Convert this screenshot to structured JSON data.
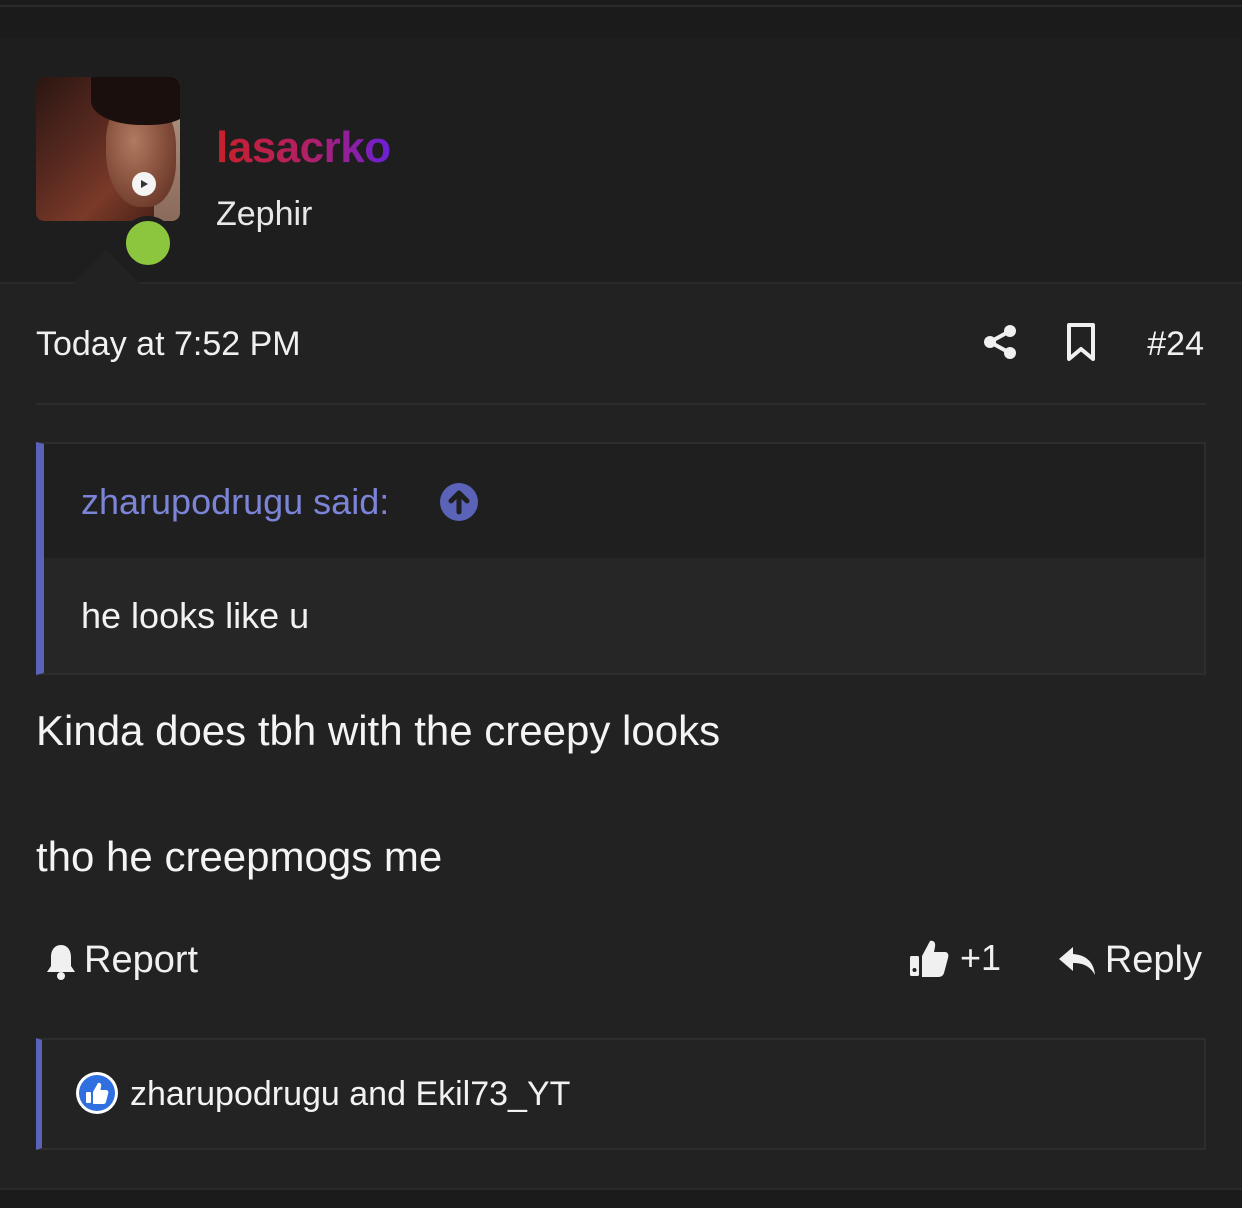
{
  "author": {
    "username": "lasacrko",
    "title": "Zephir",
    "online": true
  },
  "post": {
    "timestamp": "Today at 7:52 PM",
    "number": "#24",
    "quote": {
      "author_line": "zharupodrugu said:",
      "body": "he looks like u"
    },
    "message_lines": [
      "Kinda does tbh with the creepy looks",
      "tho he creepmogs me"
    ]
  },
  "actions": {
    "report_label": "Report",
    "like_label": "+1",
    "reply_label": "Reply"
  },
  "reactions": {
    "users_text": "zharupodrugu and Ekil73_YT"
  },
  "colors": {
    "accent": "#5a63b8",
    "quote_link": "#7b84d6",
    "online": "#8cc63f",
    "username_gradient_start": "#c8202a",
    "username_gradient_end": "#6a20d8",
    "like_badge": "#2f6fe0"
  },
  "icons": {
    "share": "share-icon",
    "bookmark": "bookmark-icon",
    "quote_jump": "arrow-up-circle-icon",
    "report": "bell-icon",
    "like": "thumbs-up-icon",
    "reply": "reply-arrow-icon",
    "reaction": "like-reaction-icon"
  }
}
